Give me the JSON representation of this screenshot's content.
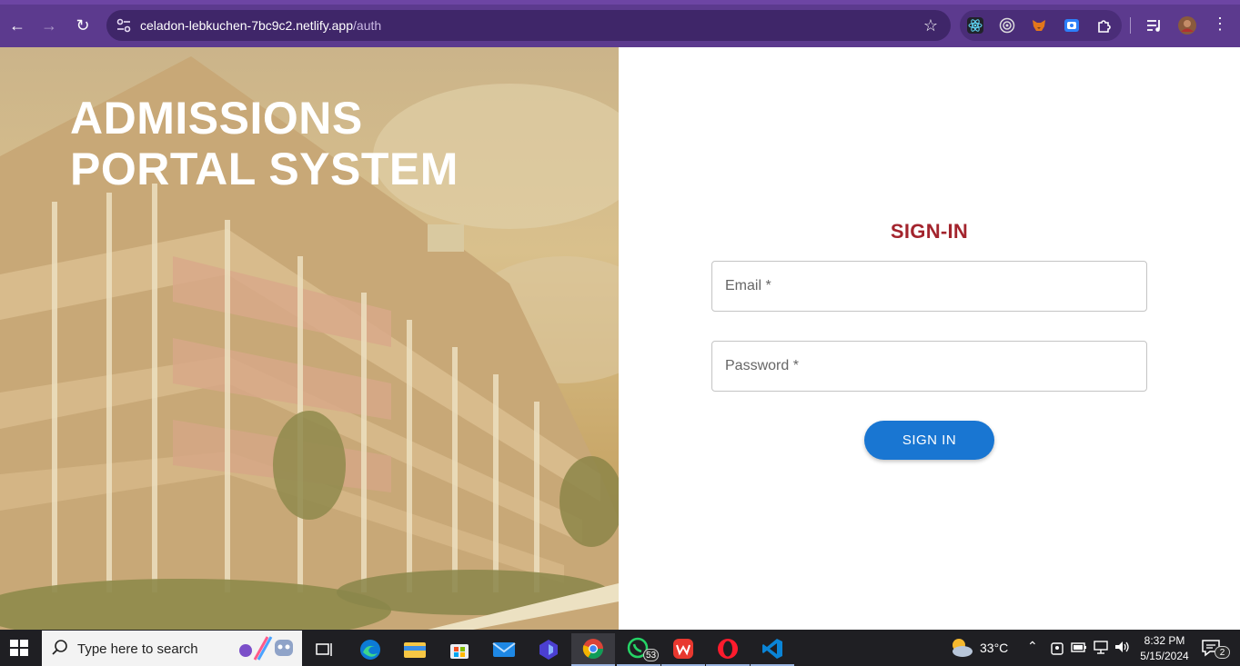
{
  "browser": {
    "url_host": "celadon-lebkuchen-7bc9c2.netlify.app",
    "url_path": "/auth"
  },
  "hero": {
    "title_line1": "ADMISSIONS",
    "title_line2": "PORTAL SYSTEM"
  },
  "form": {
    "title": "SIGN-IN",
    "email_label": "Email *",
    "password_label": "Password *",
    "submit_label": "SIGN IN"
  },
  "taskbar": {
    "search_placeholder": "Type here to search",
    "whatsapp_badge": "53",
    "temperature": "33°C",
    "time": "8:32 PM",
    "date": "5/15/2024",
    "notification_count": "2"
  },
  "colors": {
    "browser_bar": "#5c3a8e",
    "title_red": "#a3242d",
    "button_blue": "#1976d2"
  }
}
